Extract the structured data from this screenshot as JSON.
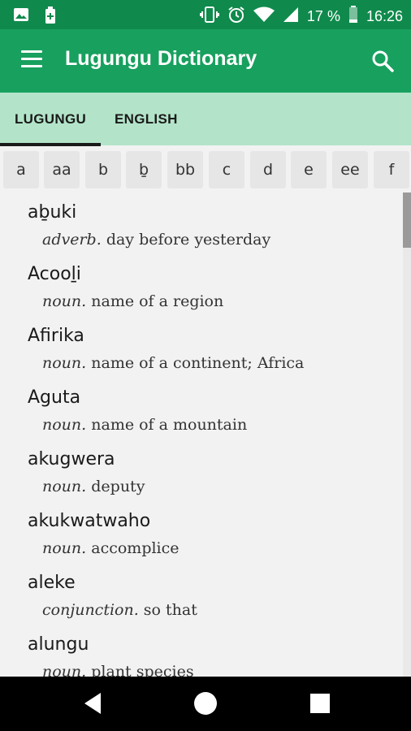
{
  "status_bar": {
    "battery_percent": "17 %",
    "time": "16:26"
  },
  "app_bar": {
    "title": "Lugungu Dictionary"
  },
  "tabs": [
    {
      "label": "LUGUNGU",
      "selected": true
    },
    {
      "label": "ENGLISH",
      "selected": false
    }
  ],
  "letters": [
    "a",
    "aa",
    "b",
    "ḇ",
    "bb",
    "c",
    "d",
    "e",
    "ee",
    "f"
  ],
  "entries": [
    {
      "word": "aḇuki",
      "pos": "adverb.",
      "definition": "day before yesterday"
    },
    {
      "word": "Acooḻi",
      "pos": "noun.",
      "definition": "name of a region"
    },
    {
      "word": "Afirika",
      "pos": "noun.",
      "definition": "name of a continent; Africa"
    },
    {
      "word": "Aguta",
      "pos": "noun.",
      "definition": "name of a mountain"
    },
    {
      "word": "akugwera",
      "pos": "noun.",
      "definition": "deputy"
    },
    {
      "word": "akukwatwaho",
      "pos": "noun.",
      "definition": "accomplice"
    },
    {
      "word": "aleke",
      "pos": "conjunction.",
      "definition": "so that"
    },
    {
      "word": "alungu",
      "pos": "noun.",
      "definition": "plant species"
    }
  ],
  "colors": {
    "status_bar": "#0f8a4c",
    "app_bar": "#18a05e",
    "tab_bar": "#b3e4c9"
  }
}
